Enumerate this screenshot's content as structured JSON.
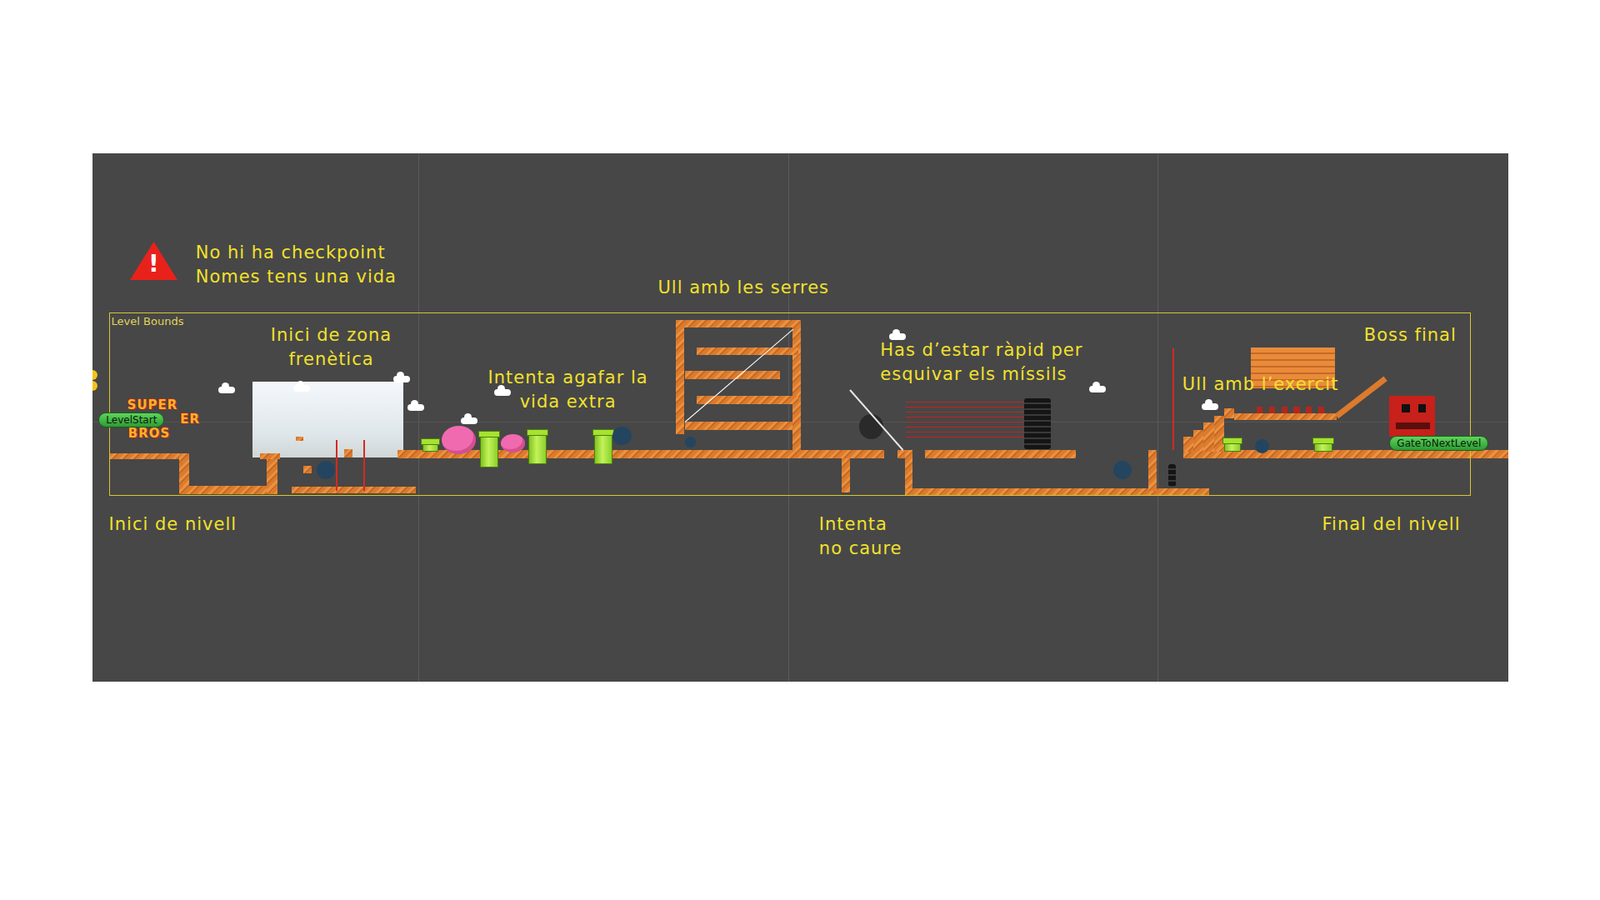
{
  "editor": {
    "bounds_label": "Level Bounds"
  },
  "warning": {
    "icon": "!",
    "lines": [
      "No hi ha checkpoint",
      "Nomes tens una vida"
    ]
  },
  "annotations": {
    "start": {
      "lines": [
        "Inici de nivell"
      ]
    },
    "frenetic": {
      "lines": [
        "Inici de zona",
        "frenètica"
      ]
    },
    "extra_life": {
      "lines": [
        "Intenta agafar la",
        "vida extra"
      ]
    },
    "saws": {
      "lines": [
        "Ull amb les serres"
      ]
    },
    "missiles": {
      "lines": [
        "Has d’estar ràpid per",
        "esquivar els míssils"
      ]
    },
    "no_fall": {
      "lines": [
        "Intenta",
        "no caure"
      ]
    },
    "army": {
      "lines": [
        "Ull amb l’exercit"
      ]
    },
    "boss": {
      "lines": [
        "Boss final"
      ]
    },
    "end": {
      "lines": [
        "Final del nivell"
      ]
    }
  },
  "markers": {
    "start": {
      "label": "LevelStart"
    },
    "gate": {
      "label": "GateToNextLevel"
    }
  },
  "logo": {
    "lines": [
      "SUPER",
      "ER",
      "BROS"
    ]
  }
}
